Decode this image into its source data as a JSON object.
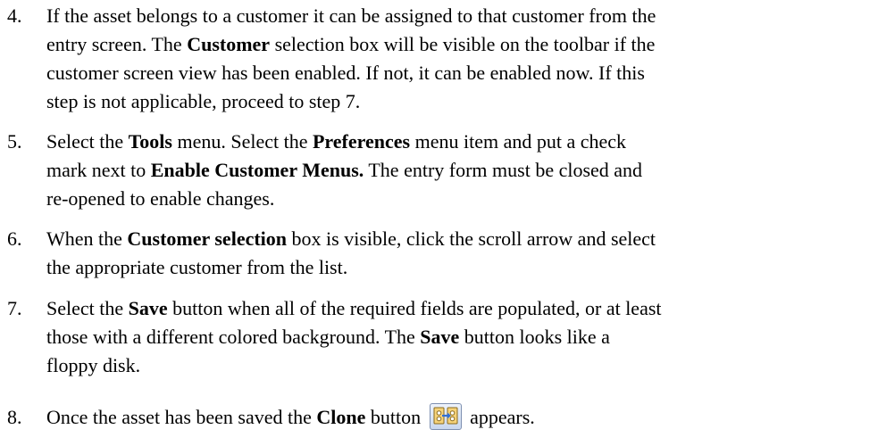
{
  "steps": [
    {
      "number": "4.",
      "lines": [
        [
          {
            "t": "If the asset belongs to a customer it can be assigned to that customer from the"
          }
        ],
        [
          {
            "t": "entry screen. The "
          },
          {
            "t": "Customer",
            "b": true
          },
          {
            "t": " selection box will be visible on the toolbar if the"
          }
        ],
        [
          {
            "t": "customer screen view has been enabled. If not, it can be enabled now. If this"
          }
        ],
        [
          {
            "t": "step is not applicable, proceed to step 7."
          }
        ]
      ]
    },
    {
      "number": "5.",
      "lines": [
        [
          {
            "t": "Select the "
          },
          {
            "t": "Tools",
            "b": true
          },
          {
            "t": " menu. Select the "
          },
          {
            "t": "Preferences",
            "b": true
          },
          {
            "t": " menu item and put a check"
          }
        ],
        [
          {
            "t": "mark next to "
          },
          {
            "t": "Enable Customer Menus.",
            "b": true
          },
          {
            "t": " The entry form must be closed and"
          }
        ],
        [
          {
            "t": "re-opened to enable changes."
          }
        ]
      ]
    },
    {
      "number": "6.",
      "lines": [
        [
          {
            "t": "When the "
          },
          {
            "t": "Customer selection",
            "b": true
          },
          {
            "t": " box is visible, click the scroll arrow and select"
          }
        ],
        [
          {
            "t": "the appropriate customer from the list."
          }
        ]
      ]
    },
    {
      "number": "7.",
      "lines": [
        [
          {
            "t": "Select the "
          },
          {
            "t": "Save",
            "b": true
          },
          {
            "t": " button when all of the required fields are populated, or at least"
          }
        ],
        [
          {
            "t": "those with a different colored background. The "
          },
          {
            "t": "Save",
            "b": true
          },
          {
            "t": " button looks like a"
          }
        ],
        [
          {
            "t": "floppy disk."
          }
        ]
      ]
    },
    {
      "number": "8.",
      "lines": [
        [
          {
            "t": "Once the asset has been saved the "
          },
          {
            "t": "Clone",
            "b": true
          },
          {
            "t": " button "
          },
          {
            "icon": "clone-icon"
          },
          {
            "t": " appears."
          }
        ]
      ]
    }
  ]
}
